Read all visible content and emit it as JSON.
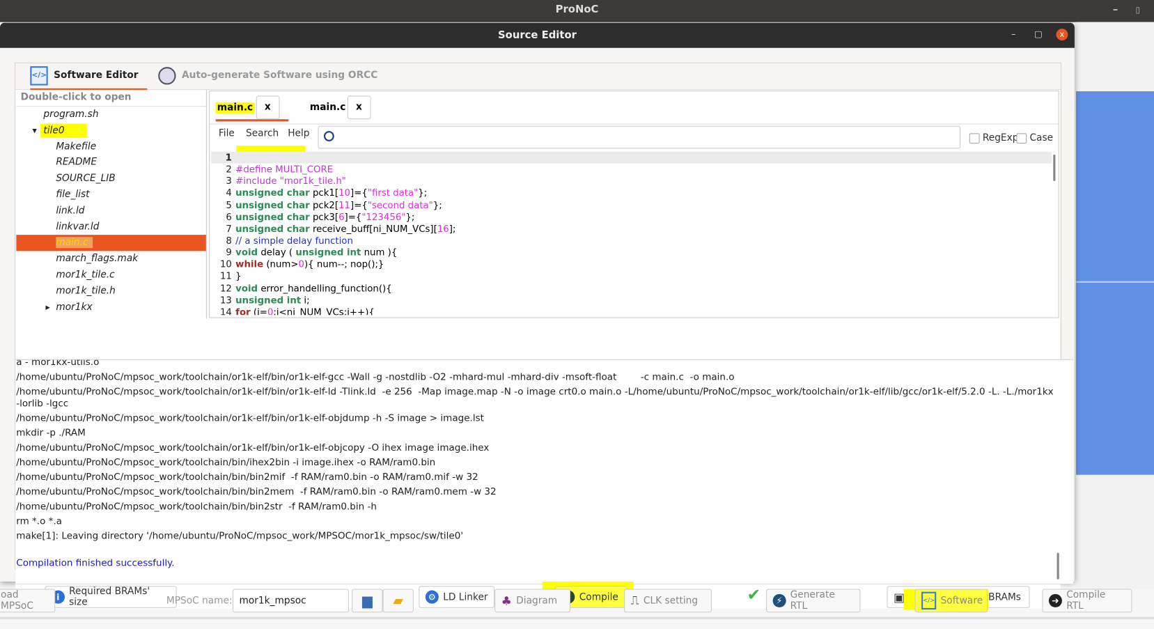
{
  "app": {
    "title": "ProNoC",
    "min": "–",
    "max": "▯"
  },
  "window": {
    "title": "Source Editor",
    "min": "–",
    "max": "▢",
    "close": "x"
  },
  "tabs": [
    {
      "label": "Software Editor",
      "icon": "software-icon",
      "active": true
    },
    {
      "label": "Auto-generate Software using ORCC",
      "icon": "orcc-icon",
      "active": false
    }
  ],
  "tree": {
    "header": "Double-click to open",
    "items": [
      {
        "label": "program.sh",
        "depth": 1
      },
      {
        "label": "tile0",
        "depth": 1,
        "expanded": true,
        "highlight": true
      },
      {
        "label": "Makefile",
        "depth": 2
      },
      {
        "label": "README",
        "depth": 2
      },
      {
        "label": "SOURCE_LIB",
        "depth": 2
      },
      {
        "label": "file_list",
        "depth": 2
      },
      {
        "label": "link.ld",
        "depth": 2
      },
      {
        "label": "linkvar.ld",
        "depth": 2
      },
      {
        "label": "main.c",
        "depth": 2,
        "selected": true
      },
      {
        "label": "march_flags.mak",
        "depth": 2
      },
      {
        "label": "mor1k_tile.c",
        "depth": 2
      },
      {
        "label": "mor1k_tile.h",
        "depth": 2
      },
      {
        "label": "mor1kx",
        "depth": 2,
        "collapsed": true
      }
    ]
  },
  "editor": {
    "file_tabs": [
      {
        "label": "main.c",
        "close": "x",
        "active": true
      },
      {
        "label": "main.c",
        "close": "x",
        "active": false
      }
    ],
    "menu": [
      "File",
      "Search",
      "Help"
    ],
    "search": {
      "value": "",
      "placeholder": ""
    },
    "regexp_label": "RegExp",
    "case_label": "Case",
    "regexp_checked": false,
    "case_checked": false,
    "lines": [
      [],
      [
        [
          "#define MULTI_CORE",
          "pp"
        ]
      ],
      [
        [
          "#include \"mor1k_tile.h\"",
          "pp"
        ]
      ],
      [
        [
          "unsigned char",
          "kw"
        ],
        [
          " pck1[",
          ""
        ],
        [
          "10",
          "nu"
        ],
        [
          "]={",
          ""
        ],
        [
          "\"first data\"",
          "nu"
        ],
        [
          "};",
          ""
        ]
      ],
      [
        [
          "unsigned char",
          "kw"
        ],
        [
          " pck2[",
          ""
        ],
        [
          "11",
          "nu"
        ],
        [
          "]={",
          ""
        ],
        [
          "\"second data\"",
          "nu"
        ],
        [
          "};",
          ""
        ]
      ],
      [
        [
          "unsigned char",
          "kw"
        ],
        [
          " pck3[",
          ""
        ],
        [
          "6",
          "nu"
        ],
        [
          "]={",
          ""
        ],
        [
          "\"123456\"",
          "nu"
        ],
        [
          "};",
          ""
        ]
      ],
      [
        [
          "unsigned char",
          "kw"
        ],
        [
          " receive_buff[ni_NUM_VCs][",
          ""
        ],
        [
          "16",
          "nu"
        ],
        [
          "];",
          ""
        ]
      ],
      [
        [
          "// a simple delay function",
          "cm"
        ]
      ],
      [
        [
          "void",
          "kw"
        ],
        [
          " delay ( ",
          ""
        ],
        [
          "unsigned int",
          "kw"
        ],
        [
          " num ){",
          ""
        ]
      ],
      [
        [
          "while",
          "kr"
        ],
        [
          " (num>",
          ""
        ],
        [
          "0",
          "nu"
        ],
        [
          "){ num--; nop();}",
          ""
        ]
      ],
      [
        [
          "}",
          ""
        ]
      ],
      [
        [
          "void",
          "kw"
        ],
        [
          " error_handelling_function(){",
          ""
        ]
      ],
      [
        [
          "unsigned int",
          "kw"
        ],
        [
          " i;",
          ""
        ]
      ],
      [
        [
          "for",
          "kr"
        ],
        [
          " (i=",
          ""
        ],
        [
          "0",
          "nu"
        ],
        [
          ";i<ni_NUM_VCs;i++){",
          ""
        ]
      ]
    ]
  },
  "log": {
    "lines": [
      "a - mor1kx-utils.o",
      "/home/ubuntu/ProNoC/mpsoc_work/toolchain/or1k-elf/bin/or1k-elf-gcc -Wall -g -nostdlib -O2 -mhard-mul -mhard-div -msoft-float        -c main.c  -o main.o",
      "/home/ubuntu/ProNoC/mpsoc_work/toolchain/or1k-elf/bin/or1k-elf-ld -Tlink.ld  -e 256  -Map image.map -N -o image crt0.o main.o -L/home/ubuntu/ProNoC/mpsoc_work/toolchain/or1k-elf/lib/gcc/or1k-elf/5.2.0 -L. -L./mor1kx -lorlib -lgcc",
      "/home/ubuntu/ProNoC/mpsoc_work/toolchain/or1k-elf/bin/or1k-elf-objdump -h -S image > image.lst",
      "mkdir -p ./RAM",
      "/home/ubuntu/ProNoC/mpsoc_work/toolchain/or1k-elf/bin/or1k-elf-objcopy -O ihex image image.ihex",
      "/home/ubuntu/ProNoC/mpsoc_work/toolchain/bin/ihex2bin -i image.ihex -o RAM/ram0.bin",
      "/home/ubuntu/ProNoC/mpsoc_work/toolchain/bin/bin2mif  -f RAM/ram0.bin -o RAM/ram0.mif -w 32",
      "/home/ubuntu/ProNoC/mpsoc_work/toolchain/bin/bin2mem  -f RAM/ram0.bin -o RAM/ram0.mem -w 32",
      "/home/ubuntu/ProNoC/mpsoc_work/toolchain/bin/bin2str  -f RAM/ram0.bin -h",
      "rm *.o *.a",
      "make[1]: Leaving directory '/home/ubuntu/ProNoC/mpsoc_work/MPSOC/mor1k_mpsoc/sw/tile0'"
    ],
    "status": "Compilation finished successfully.",
    "status_color": "#1a1acc"
  },
  "buttons": {
    "brams": "Required BRAMs' size",
    "ld": "LD Linker",
    "compile": "Compile",
    "program": "Program FPGA's BRAMs",
    "success_icon": "checkmark-icon"
  },
  "mainbar": {
    "load": "oad MPSoC",
    "name_label": "MPSoC name:",
    "name_value": "mor1k_mpsoc",
    "diagram": "Diagram",
    "clk": "CLK setting",
    "gen": "Generate RTL",
    "software": "Software",
    "compile_rtl": "Compile RTL"
  },
  "colors": {
    "accent": "#e95420",
    "highlight": "#ffff00",
    "selection_text": "#ffd700"
  }
}
